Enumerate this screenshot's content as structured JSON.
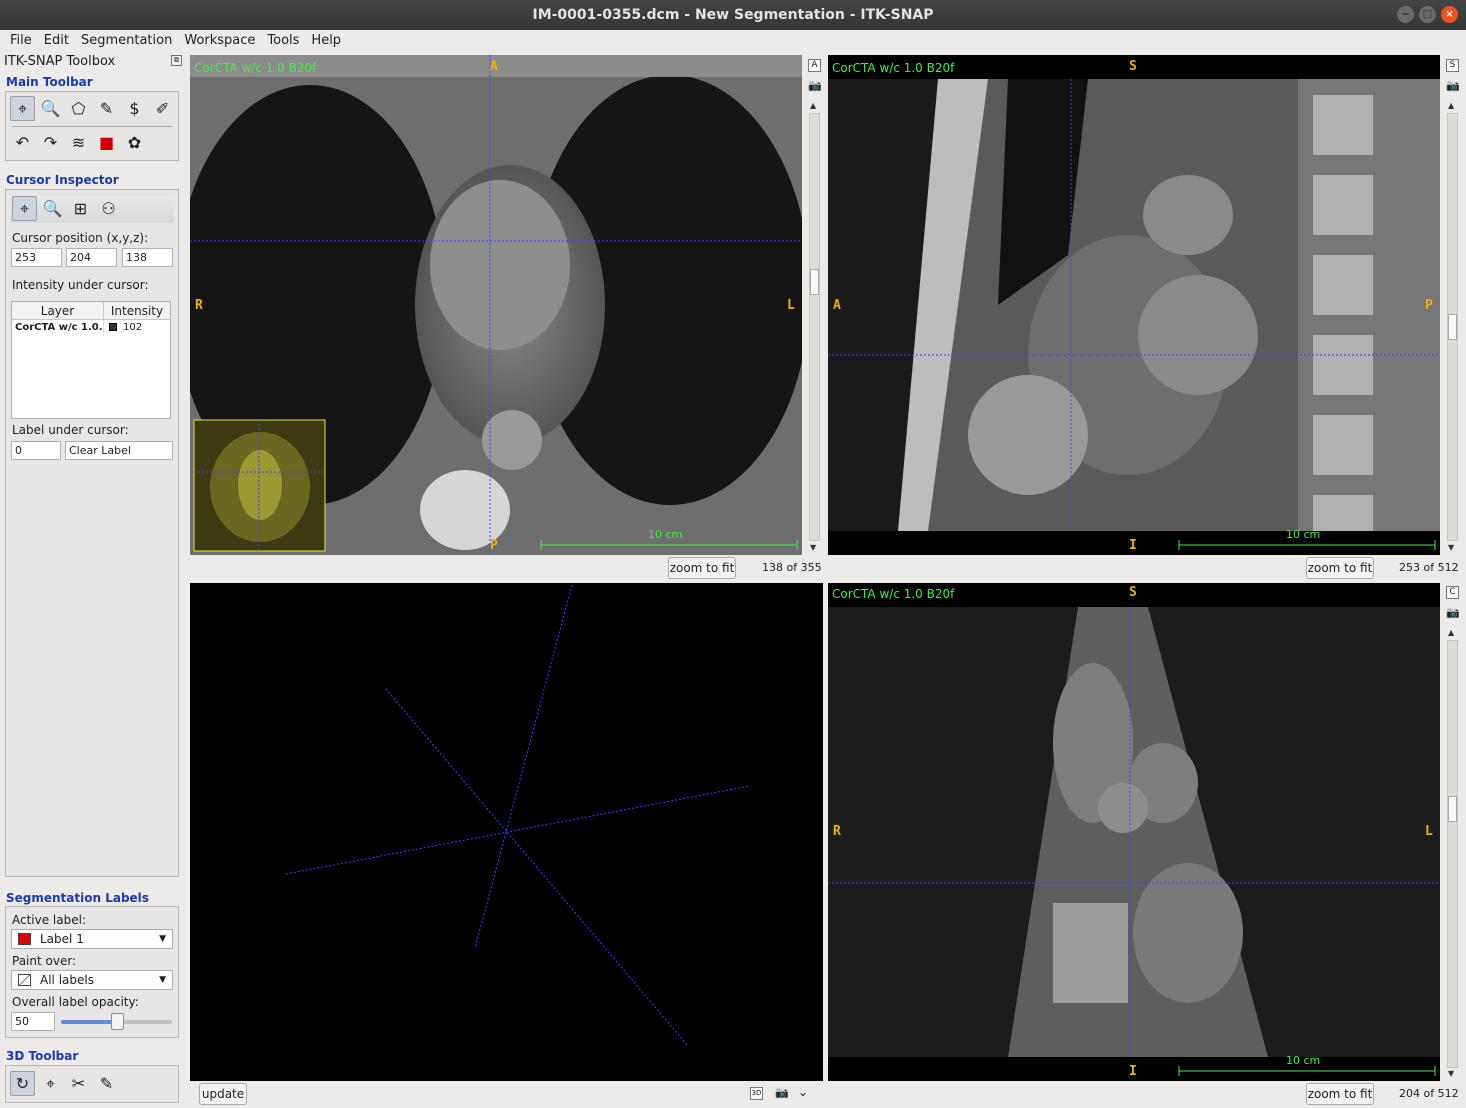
{
  "window": {
    "title": "IM-0001-0355.dcm - New Segmentation - ITK-SNAP",
    "controls": [
      "−",
      "□",
      "×"
    ]
  },
  "menu": [
    "File",
    "Edit",
    "Segmentation",
    "Workspace",
    "Tools",
    "Help"
  ],
  "toolbox": {
    "title": "ITK-SNAP Toolbox",
    "main_toolbar": {
      "title": "Main Toolbar",
      "tools": [
        {
          "name": "crosshair-tool-icon",
          "glyph": "⌖",
          "selected": true
        },
        {
          "name": "zoom-pan-tool-icon",
          "glyph": "🔍"
        },
        {
          "name": "polygon-tool-icon",
          "glyph": "⬠"
        },
        {
          "name": "paintbrush-tool-icon",
          "glyph": "✎"
        },
        {
          "name": "snake-tool-icon",
          "glyph": "$"
        },
        {
          "name": "annotation-tool-icon",
          "glyph": "✐"
        }
      ],
      "actions": [
        {
          "name": "undo-icon",
          "glyph": "↶"
        },
        {
          "name": "redo-icon",
          "glyph": "↷"
        },
        {
          "name": "layers-icon",
          "glyph": "≋"
        },
        {
          "name": "label-editor-icon",
          "glyph": "■"
        },
        {
          "name": "color-palette-icon",
          "glyph": "✿"
        }
      ]
    },
    "cursor_inspector": {
      "title": "Cursor Inspector",
      "position_label": "Cursor position (x,y,z):",
      "x": "253",
      "y": "204",
      "z": "138",
      "intensity_label": "Intensity under cursor:",
      "columns": [
        "Layer",
        "Intensity"
      ],
      "rows": [
        {
          "layer": "CorCTA w/c  1.0...",
          "intensity": "102"
        }
      ],
      "label_label": "Label under cursor:",
      "label_id": "0",
      "label_name": "Clear Label"
    },
    "segmentation_labels": {
      "title": "Segmentation Labels",
      "active_label_caption": "Active label:",
      "active_label": "Label 1",
      "active_color": "#e00000",
      "paint_over_caption": "Paint over:",
      "paint_over": "All labels",
      "opacity_caption": "Overall label opacity:",
      "opacity": "50",
      "opacity_fraction": 0.5
    },
    "toolbar_3d": {
      "title": "3D Toolbar"
    }
  },
  "views": {
    "axial": {
      "overlay": "CorCTA w/c  1.0  B20f",
      "top": "A",
      "bottom": "P",
      "left": "R",
      "right": "L",
      "scale": "10 cm",
      "zoom": "zoom to fit",
      "slice": "138 of 355",
      "side_button": "A"
    },
    "sagittal": {
      "overlay": "CorCTA w/c  1.0  B20f",
      "top": "S",
      "bottom": "I",
      "left": "A",
      "right": "P",
      "scale": "10 cm",
      "zoom": "zoom to fit",
      "slice": "253 of 512",
      "side_button": "S"
    },
    "coronal": {
      "overlay": "CorCTA w/c  1.0  B20f",
      "top": "S",
      "bottom": "I",
      "left": "R",
      "right": "L",
      "scale": "10 cm",
      "zoom": "zoom to fit",
      "slice": "204 of 512",
      "side_button": "C"
    },
    "three_d": {
      "update": "update",
      "icon_3d": "3D"
    }
  }
}
